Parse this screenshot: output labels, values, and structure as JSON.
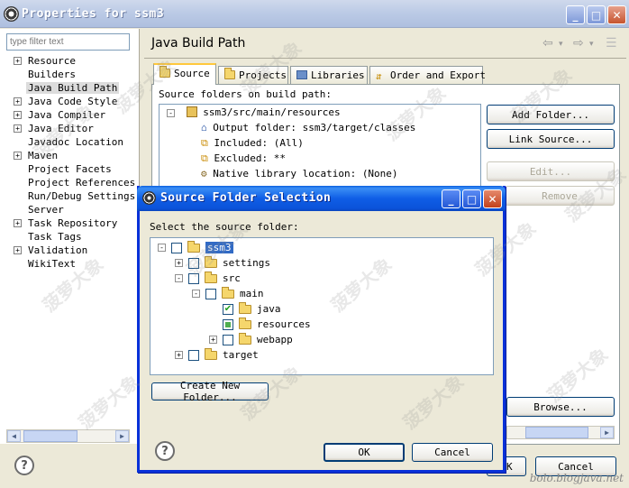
{
  "window": {
    "title": "Properties for ssm3",
    "caption_min": "_",
    "caption_max": "□",
    "caption_close": "✕"
  },
  "left": {
    "filter_placeholder": "type filter text",
    "items": [
      {
        "label": "Resource",
        "expandable": true
      },
      {
        "label": "Builders",
        "expandable": false
      },
      {
        "label": "Java Build Path",
        "expandable": false,
        "selected": true
      },
      {
        "label": "Java Code Style",
        "expandable": true
      },
      {
        "label": "Java Compiler",
        "expandable": true
      },
      {
        "label": "Java Editor",
        "expandable": true
      },
      {
        "label": "Javadoc Location",
        "expandable": false
      },
      {
        "label": "Maven",
        "expandable": true
      },
      {
        "label": "Project Facets",
        "expandable": false
      },
      {
        "label": "Project References",
        "expandable": false
      },
      {
        "label": "Run/Debug Settings",
        "expandable": false
      },
      {
        "label": "Server",
        "expandable": false
      },
      {
        "label": "Task Repository",
        "expandable": true
      },
      {
        "label": "Task Tags",
        "expandable": false
      },
      {
        "label": "Validation",
        "expandable": true
      },
      {
        "label": "WikiText",
        "expandable": false
      }
    ]
  },
  "page": {
    "title": "Java Build Path",
    "tabs": [
      "Source",
      "Projects",
      "Libraries",
      "Order and Export"
    ],
    "source_label": "Source folders on build path:",
    "source_tree": [
      "ssm3/src/main/resources",
      "Output folder: ssm3/target/classes",
      "Included: (All)",
      "Excluded: **",
      "Native library location: (None)"
    ],
    "buttons": {
      "add_folder": "Add Folder...",
      "link_source": "Link Source...",
      "edit": "Edit...",
      "remove": "Remove",
      "browse": "Browse...",
      "ok": "OK",
      "cancel": "Cancel"
    }
  },
  "dialog": {
    "title": "Source Folder Selection",
    "label": "Select the source folder:",
    "tree": [
      {
        "label": "ssm3",
        "level": 0,
        "expander": "-",
        "checked": "none",
        "selected": true
      },
      {
        "label": "settings",
        "level": 1,
        "expander": "+",
        "checked": "none"
      },
      {
        "label": "src",
        "level": 1,
        "expander": "-",
        "checked": "none"
      },
      {
        "label": "main",
        "level": 2,
        "expander": "-",
        "checked": "none"
      },
      {
        "label": "java",
        "level": 3,
        "expander": "",
        "checked": "checked"
      },
      {
        "label": "resources",
        "level": 3,
        "expander": "",
        "checked": "partial"
      },
      {
        "label": "webapp",
        "level": 3,
        "expander": "+",
        "checked": "none"
      },
      {
        "label": "target",
        "level": 1,
        "expander": "+",
        "checked": "none"
      }
    ],
    "create_folder": "Create New Folder...",
    "ok": "OK",
    "cancel": "Cancel",
    "help": "?"
  },
  "watermark": {
    "text": "bolo.blogjava.net",
    "glyph": "菠萝大象"
  },
  "colors": {
    "xp_blue": "#0831d9",
    "selection": "#316ac5",
    "tab_highlight": "#ffc83c"
  }
}
